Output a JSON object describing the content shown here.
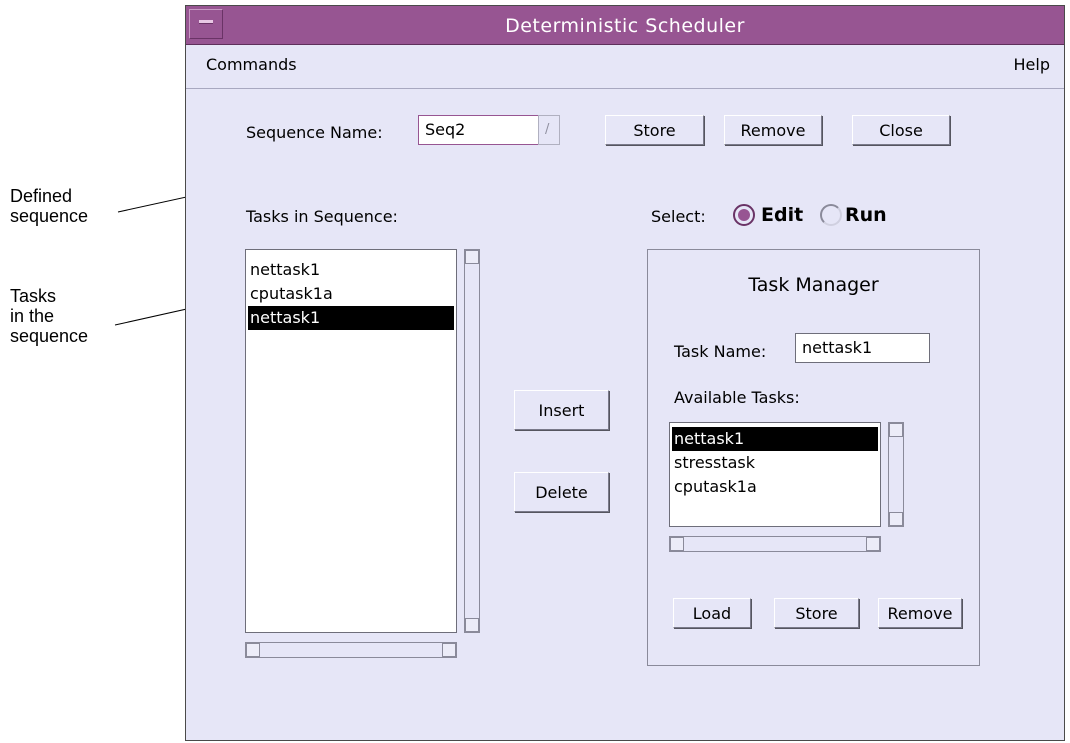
{
  "annotations": {
    "defined_sequence": [
      "Defined",
      "sequence"
    ],
    "tasks_in_sequence": [
      "Tasks",
      "in the",
      "sequence"
    ]
  },
  "window": {
    "title": "Deterministic Scheduler"
  },
  "menubar": {
    "commands": "Commands",
    "help": "Help"
  },
  "sequence": {
    "name_label": "Sequence Name:",
    "name_value": "Seq2",
    "store": "Store",
    "remove": "Remove",
    "close": "Close"
  },
  "tasks_panel": {
    "label": "Tasks in Sequence:",
    "items": [
      "nettask1",
      "cputask1a",
      "nettask1"
    ],
    "selected_index": 2
  },
  "middle_buttons": {
    "insert": "Insert",
    "delete": "Delete"
  },
  "select": {
    "label": "Select:",
    "edit": "Edit",
    "run": "Run",
    "selected": "Edit"
  },
  "task_manager": {
    "title": "Task Manager",
    "task_name_label": "Task Name:",
    "task_name_value": "nettask1",
    "available_label": "Available Tasks:",
    "available": [
      "nettask1",
      "stresstask",
      "cputask1a"
    ],
    "selected_index": 0,
    "load": "Load",
    "store": "Store",
    "remove": "Remove"
  },
  "colors": {
    "titlebar": "#975592",
    "window_bg": "#e6e6f7",
    "selection_bg": "#000000",
    "radio_on": "#975592"
  }
}
